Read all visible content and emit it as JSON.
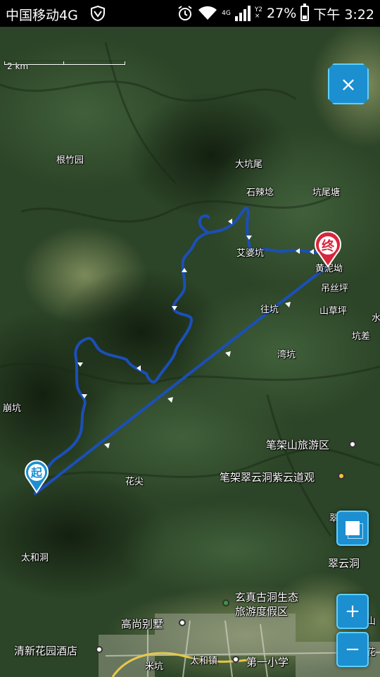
{
  "status_bar": {
    "carrier": "中国移动4G",
    "network_type": "4G",
    "sim_indicator": "Y2",
    "battery": "27%",
    "battery_level": 0.27,
    "time": "下午 3:22"
  },
  "map": {
    "scale_label": "2 km",
    "place_labels": [
      "根竹园",
      "大坑尾",
      "石辣埝",
      "坑尾塘",
      "艾婆坑",
      "黄泥坳",
      "吊丝坪",
      "往坑",
      "山草坪",
      "坑差",
      "湾坑",
      "崩坑",
      "笔架山旅游区",
      "笔架翠云洞紫云道观",
      "花尖",
      "翠云洞",
      "太和洞",
      "翠云洞",
      "玄真古洞生态",
      "旅游度假区",
      "高尚别墅",
      "清新花园酒店",
      "米坑",
      "太和镇",
      "第一小学",
      "红花",
      "上山",
      "水"
    ],
    "start_marker": "起",
    "end_marker": "终"
  },
  "controls": {
    "close": "×",
    "zoom_in": "+",
    "zoom_out": "−"
  },
  "colors": {
    "route": "#1b4fb8",
    "button": "#1b8fd0",
    "start_marker": "#1b8fd0",
    "end_marker": "#d7263d"
  }
}
